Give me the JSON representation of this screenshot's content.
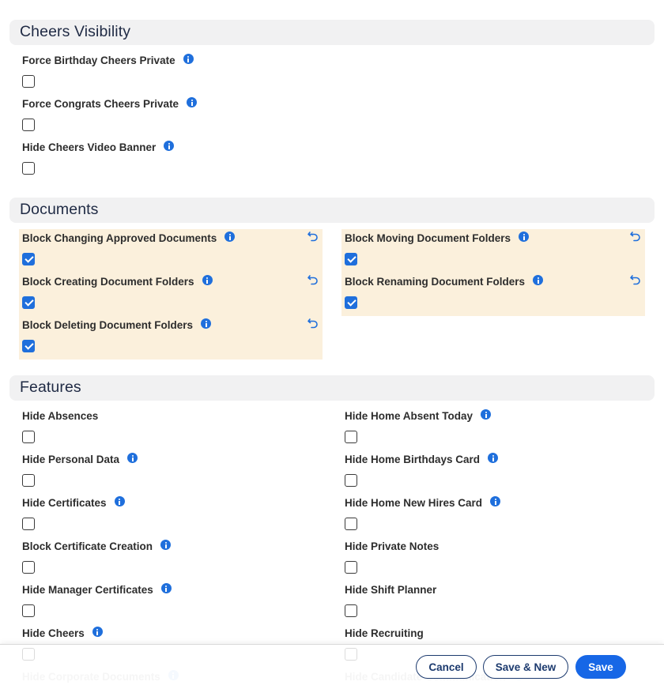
{
  "sections": {
    "cheers": {
      "title": "Cheers Visibility",
      "fields": [
        {
          "label": "Force Birthday Cheers Private",
          "checked": false,
          "info": true
        },
        {
          "label": "Force Congrats Cheers Private",
          "checked": false,
          "info": true
        },
        {
          "label": "Hide Cheers Video Banner",
          "checked": false,
          "info": true
        }
      ]
    },
    "documents": {
      "title": "Documents",
      "left": [
        {
          "label": "Block Changing Approved Documents",
          "checked": true,
          "info": true,
          "modified": true
        },
        {
          "label": "Block Creating Document Folders",
          "checked": true,
          "info": true,
          "modified": true
        },
        {
          "label": "Block Deleting Document Folders",
          "checked": true,
          "info": true,
          "modified": true
        }
      ],
      "right": [
        {
          "label": "Block Moving Document Folders",
          "checked": true,
          "info": true,
          "modified": true
        },
        {
          "label": "Block Renaming Document Folders",
          "checked": true,
          "info": true,
          "modified": true
        }
      ]
    },
    "features": {
      "title": "Features",
      "left": [
        {
          "label": "Hide Absences",
          "checked": false,
          "info": false
        },
        {
          "label": "Hide Personal Data",
          "checked": false,
          "info": true
        },
        {
          "label": "Hide Certificates",
          "checked": false,
          "info": true
        },
        {
          "label": "Block Certificate Creation",
          "checked": false,
          "info": true
        },
        {
          "label": "Hide Manager Certificates",
          "checked": false,
          "info": true
        },
        {
          "label": "Hide Cheers",
          "checked": false,
          "info": true
        },
        {
          "label": "Hide Corporate Documents",
          "checked": false,
          "info": true
        }
      ],
      "right": [
        {
          "label": "Hide Home Absent Today",
          "checked": false,
          "info": true
        },
        {
          "label": "Hide Home Birthdays Card",
          "checked": false,
          "info": true
        },
        {
          "label": "Hide Home New Hires Card",
          "checked": false,
          "info": true
        },
        {
          "label": "Hide Private Notes",
          "checked": false,
          "info": false
        },
        {
          "label": "Hide Shift Planner",
          "checked": false,
          "info": false
        },
        {
          "label": "Hide Recruiting",
          "checked": false,
          "info": false
        },
        {
          "label": "Hide Candidate Communication",
          "checked": false,
          "info": true
        }
      ]
    }
  },
  "footer": {
    "cancel_label": "Cancel",
    "save_new_label": "Save & New",
    "save_label": "Save"
  },
  "colors": {
    "accent": "#1767e6",
    "modified_bg": "#fbf0dc",
    "header_bg": "#f1f1f2"
  },
  "icons": {
    "info": "info-icon",
    "reset": "undo-icon"
  }
}
